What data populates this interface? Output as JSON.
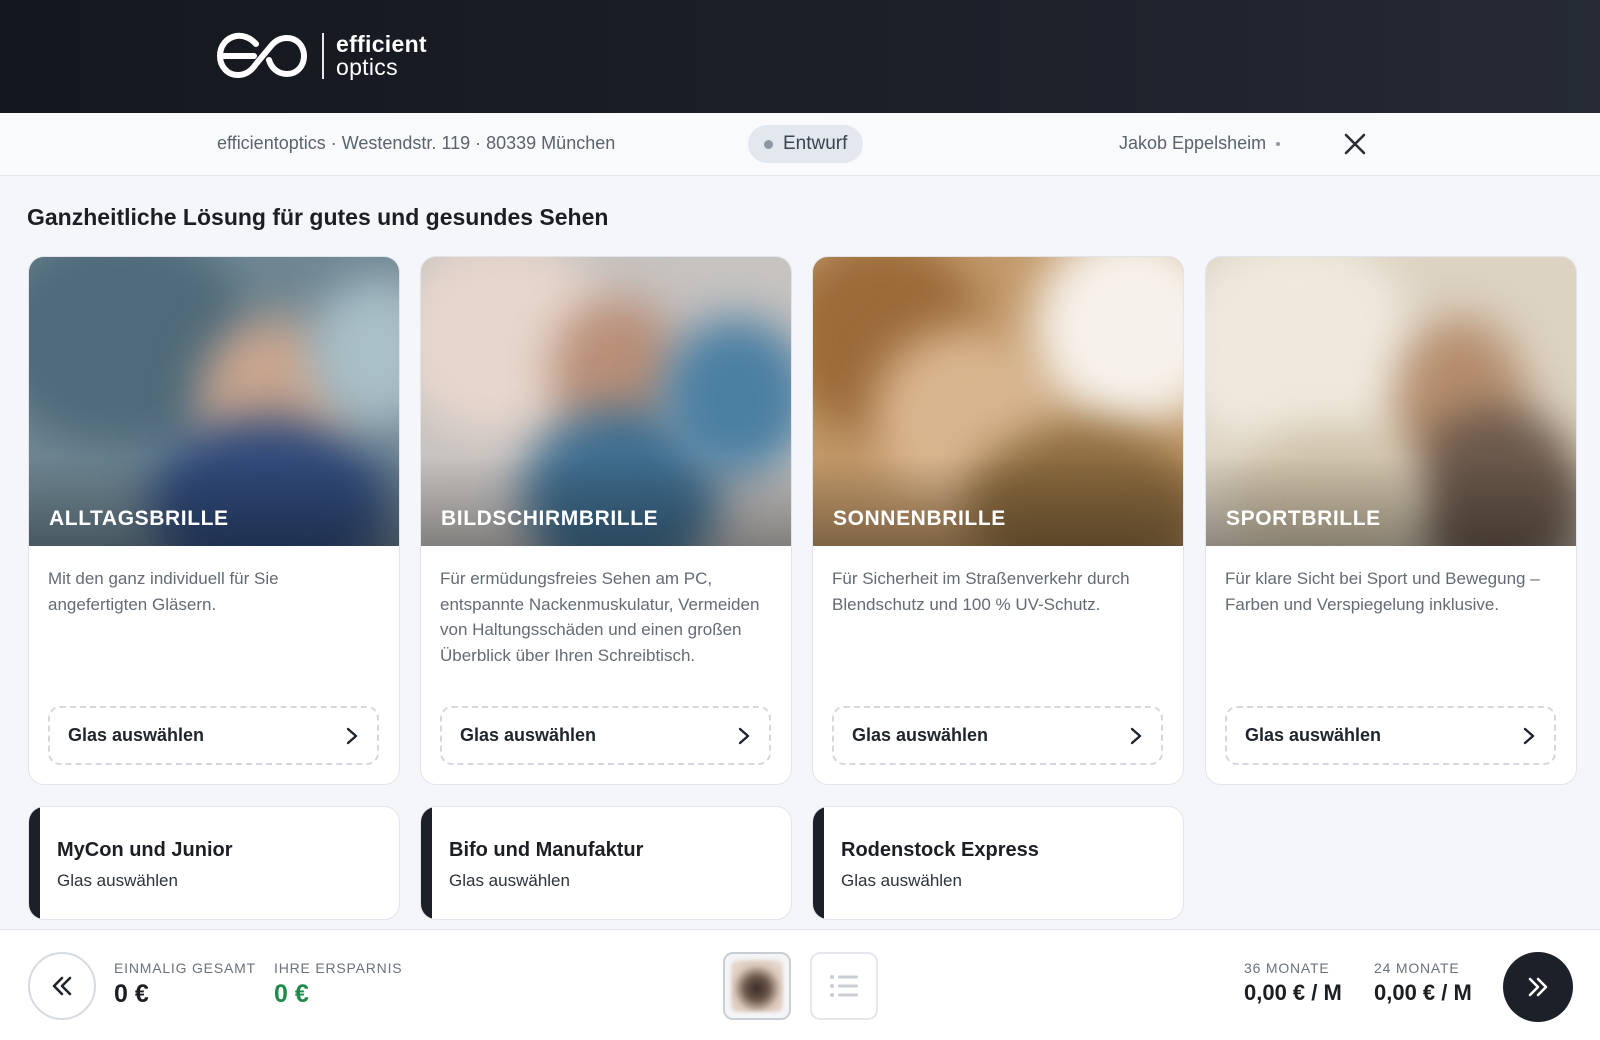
{
  "header": {
    "logo": {
      "line1": "efficient",
      "line2": "optics",
      "icon": "eo-logo-icon"
    }
  },
  "subheader": {
    "store_address": "efficientoptics · Westendstr. 119 · 80339 München",
    "status": "Entwurf",
    "user": "Jakob Eppelsheim",
    "close_icon": "close-icon"
  },
  "main": {
    "title": "Ganzheitliche Lösung für gutes und gesundes Sehen",
    "cards": [
      {
        "label": "ALLTAGSBRILLE",
        "description": "Mit den ganz individuell für Sie angefertigten Gläsern.",
        "button": "Glas auswählen"
      },
      {
        "label": "BILDSCHIRMBRILLE",
        "description": "Für ermüdungsfreies Sehen am PC, entspannte Nackenmuskulatur, Vermeiden von Haltungsschäden und einen großen Überblick über Ihren Schreibtisch.",
        "button": "Glas auswählen"
      },
      {
        "label": "SONNENBRILLE",
        "description": "Für Sicherheit im Straßenverkehr durch Blendschutz und 100 % UV-Schutz.",
        "button": "Glas auswählen"
      },
      {
        "label": "SPORTBRILLE",
        "description": "Für klare Sicht bei Sport und Bewegung – Farben und Verspiegelung inklusive.",
        "button": "Glas auswählen"
      }
    ],
    "brands": [
      {
        "title": "MyCon und Junior",
        "sub": "Glas auswählen"
      },
      {
        "title": "Bifo und Manufaktur",
        "sub": "Glas auswählen"
      },
      {
        "title": "Rodenstock Express",
        "sub": "Glas auswählen"
      }
    ]
  },
  "footer": {
    "total_label": "EINMALIG GESAMT",
    "total_value": "0 €",
    "savings_label": "IHRE ERSPARNIS",
    "savings_value": "0 €",
    "rate36_label": "36 MONATE",
    "rate36_value": "0,00 € / M",
    "rate24_label": "24 MONATE",
    "rate24_value": "0,00 € / M",
    "colors": {
      "savings": "#1f8a4c",
      "dark": "#1c2028"
    }
  }
}
